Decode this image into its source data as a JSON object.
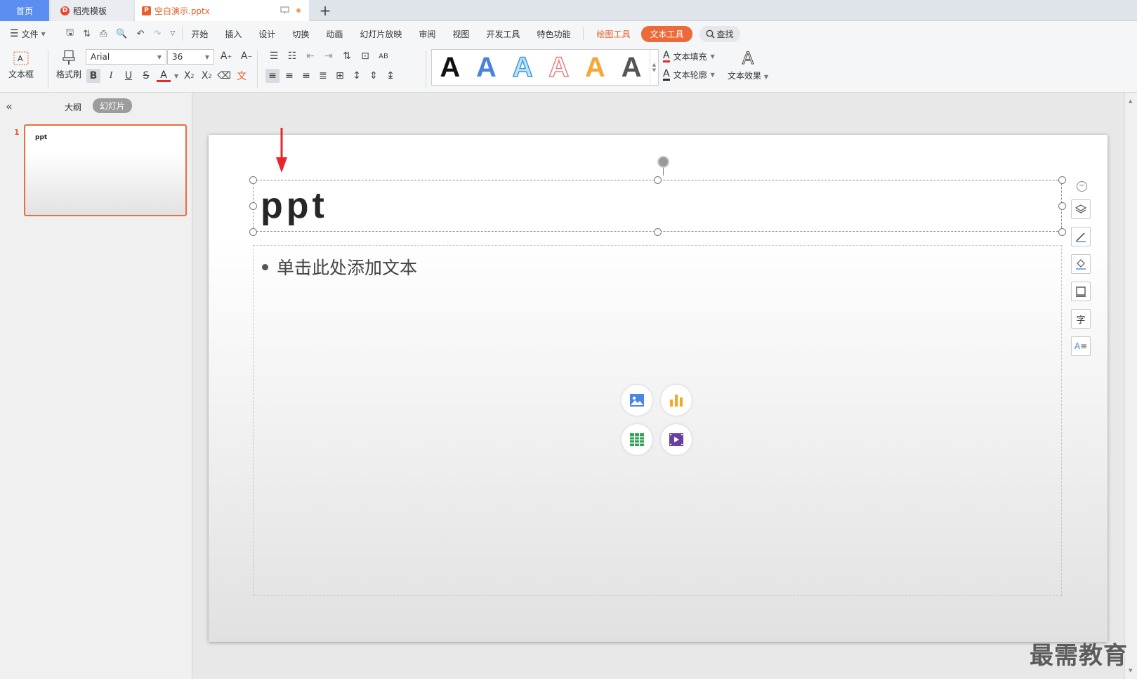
{
  "tabs": {
    "home": "首页",
    "template": "稻壳模板",
    "document": "空白演示.pptx",
    "new_tab": "+"
  },
  "menu": {
    "file": "文件",
    "items": [
      "开始",
      "插入",
      "设计",
      "切换",
      "动画",
      "幻灯片放映",
      "审阅",
      "视图",
      "开发工具",
      "特色功能"
    ],
    "drawing_tools": "绘图工具",
    "text_tools": "文本工具",
    "search": "查找"
  },
  "ribbon": {
    "textbox_label": "文本框",
    "format_painter_label": "格式刷",
    "font_name": "Arial",
    "font_size": "36",
    "text_fill_label": "文本填充",
    "text_outline_label": "文本轮廓",
    "text_effect_label": "文本效果",
    "gallery_letters": [
      "A",
      "A",
      "A",
      "A",
      "A",
      "A"
    ]
  },
  "left_panel": {
    "outline_view": "大纲",
    "slide_view": "幻灯片",
    "slide_number": "1",
    "thumb_title": "ppt"
  },
  "slide": {
    "title": "ppt",
    "body_placeholder": "单击此处添加文本"
  },
  "watermark": "最需教育",
  "colors": {
    "accent": "#ec6a3a",
    "home_tab": "#5b8ef0",
    "annotation_arrow": "#e8262c"
  }
}
